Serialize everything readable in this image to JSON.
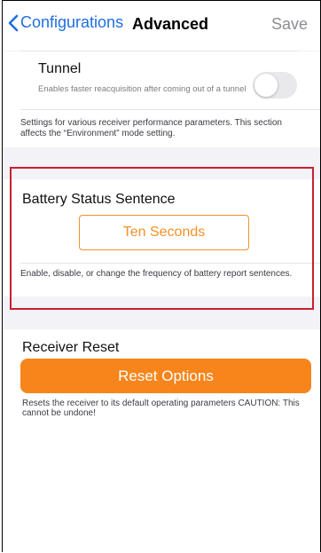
{
  "nav": {
    "back_label": "Configurations",
    "title": "Advanced",
    "save_label": "Save"
  },
  "tunnel": {
    "title": "Tunnel",
    "description": "Enables faster reacquisition after coming out of a tunnel",
    "enabled": false,
    "footer": "Settings for various receiver performance parameters. This section affects the “Environment” mode setting."
  },
  "battery": {
    "title": "Battery Status Sentence",
    "value_label": "Ten Seconds",
    "footer": "Enable, disable, or change the frequency of battery report sentences."
  },
  "reset": {
    "title": "Receiver Reset",
    "button_label": "Reset Options",
    "note": "Resets the receiver to its default operating parameters CAUTION: This cannot be undone!"
  },
  "colors": {
    "accent_blue": "#1f6fe0",
    "accent_orange": "#f4912a",
    "highlight_red": "#c8202e"
  }
}
